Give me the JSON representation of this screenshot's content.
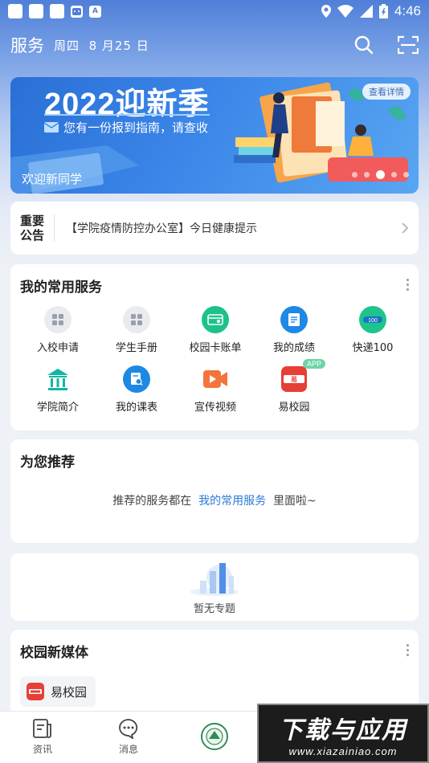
{
  "status_bar": {
    "time": "4:46",
    "app_icon_letter": "A"
  },
  "header": {
    "title": "服务",
    "weekday": "周四",
    "date": "8 月25 日"
  },
  "banner": {
    "title": "2022迎新季",
    "subtitle": "您有一份报到指南，请查收",
    "caption": "欢迎新同学",
    "detail_button": "查看详情",
    "slide_count": 5,
    "active_slide": 3
  },
  "notice": {
    "tag_line1": "重要",
    "tag_line2": "公告",
    "text": "【学院疫情防控办公室】今日健康提示"
  },
  "services": {
    "title": "我的常用服务",
    "items": [
      {
        "label": "入校申请",
        "icon": "grid-icon",
        "color": "#e9ebef"
      },
      {
        "label": "学生手册",
        "icon": "grid-icon",
        "color": "#e9ebef"
      },
      {
        "label": "校园卡账单",
        "icon": "card-wallet-icon",
        "color": "#1cc28b"
      },
      {
        "label": "我的成绩",
        "icon": "report-icon",
        "color": "#1e88e5"
      },
      {
        "label": "快递100",
        "icon": "express-icon",
        "color": "#1fc48c"
      },
      {
        "label": "学院简介",
        "icon": "institution-icon",
        "color": "#12b5a3"
      },
      {
        "label": "我的课表",
        "icon": "schedule-icon",
        "color": "#1e88e5"
      },
      {
        "label": "宣传视频",
        "icon": "video-icon",
        "color": "#f4743b"
      },
      {
        "label": "易校园",
        "icon": "yixiaoyuan-logo-icon",
        "color": "#e63f36",
        "badge": "APP"
      }
    ]
  },
  "recommend": {
    "title": "为您推荐",
    "text_before": "推荐的服务都在",
    "link": "我的常用服务",
    "text_after": "里面啦~"
  },
  "topics": {
    "empty_label": "暂无专题"
  },
  "media": {
    "title": "校园新媒体",
    "chip_label": "易校园"
  },
  "bottom_nav": {
    "items": [
      {
        "label": "资讯",
        "icon": "news-icon"
      },
      {
        "label": "消息",
        "icon": "message-icon"
      },
      {
        "label": "",
        "icon": "school-emblem-icon"
      }
    ]
  },
  "watermark": {
    "title": "下载与应用",
    "url": "www.xiazainiao.com"
  }
}
